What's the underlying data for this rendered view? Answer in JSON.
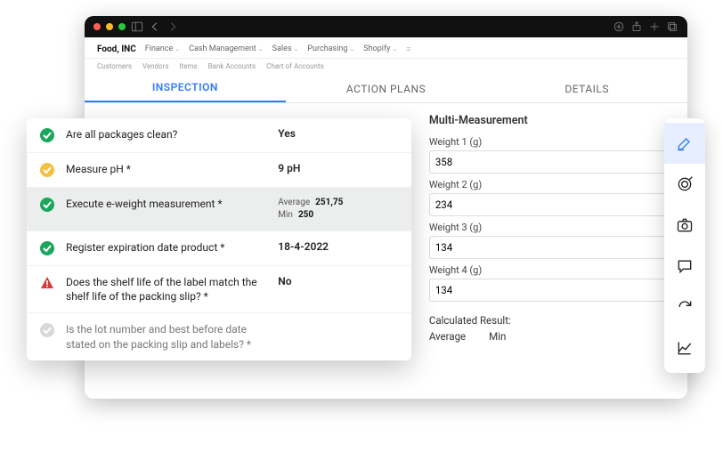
{
  "menubar": {
    "brand": "Food, INC",
    "items": [
      "Finance",
      "Cash Management",
      "Sales",
      "Purchasing",
      "Shopify"
    ]
  },
  "submenu": [
    "Customers",
    "Vendors",
    "Items",
    "Bank Accounts",
    "Chart of Accounts"
  ],
  "tabs": {
    "inspection": "INSPECTION",
    "plans": "ACTION PLANS",
    "details": "DETAILS"
  },
  "inspection": [
    {
      "icon": "check-green",
      "q": "Are all packages clean?",
      "a": "Yes",
      "bold": true
    },
    {
      "icon": "check-amber",
      "q": "Measure pH *",
      "a": "9 pH",
      "bold": true
    },
    {
      "icon": "check-green",
      "q": "Execute e-weight measurement *",
      "mini": {
        "l1": "Average",
        "v1": "251,75",
        "l2": "Min",
        "v2": "250"
      }
    },
    {
      "icon": "check-green",
      "q": "Register expiration date product *",
      "a": "18-4-2022",
      "bold": true
    },
    {
      "icon": "warn-red",
      "q": "Does the shelf life of the label match the shelf life of the packing slip? *",
      "a": "No",
      "bold": true
    },
    {
      "icon": "check-grey",
      "q": "Is the lot number and best before date stated on the packing slip and labels? *",
      "a": ""
    }
  ],
  "measurement": {
    "title": "Multi-Measurement",
    "fields": [
      {
        "label": "Weight 1 (g)",
        "value": "358"
      },
      {
        "label": "Weight 2 (g)",
        "value": "234"
      },
      {
        "label": "Weight 3 (g)",
        "value": "134"
      },
      {
        "label": "Weight 4 (g)",
        "value": "134"
      }
    ],
    "calc_title": "Calculated Result:",
    "calc_cols": [
      "Average",
      "Min"
    ]
  },
  "side_icons": [
    "edit-icon",
    "target-icon",
    "camera-icon",
    "comment-icon",
    "redo-icon",
    "chart-icon"
  ]
}
